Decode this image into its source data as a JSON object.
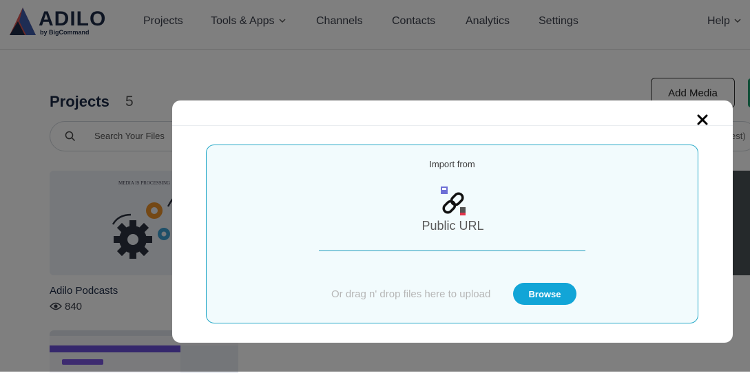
{
  "brand": {
    "name": "ADILO",
    "tagline": "by BigCommand"
  },
  "nav": {
    "items": [
      "Projects",
      "Tools & Apps",
      "Channels",
      "Contacts",
      "Analytics",
      "Settings"
    ],
    "help": "Help"
  },
  "page": {
    "title": "Projects",
    "count": "5",
    "add_media": "Add Media",
    "search_placeholder": "Search Your Files",
    "sort_partial": "est)"
  },
  "cards": [
    {
      "thumb_text": "MEDIA IS PROCESSING",
      "title": "Adilo Podcasts",
      "views": "840"
    }
  ],
  "modal": {
    "import_label": "Import from",
    "option_label": "Public URL",
    "drag_text": "Or drag n' drop files here to upload",
    "browse_label": "Browse"
  },
  "colors": {
    "accent": "#12a5d7",
    "dropzone_border": "#26a9c8",
    "dropzone_bg": "#f2fbfd",
    "brand_navy": "#1d2b47"
  },
  "icons": [
    "logo-icon",
    "chevron-down-icon",
    "search-icon",
    "eye-icon",
    "close-icon",
    "link-icon"
  ]
}
